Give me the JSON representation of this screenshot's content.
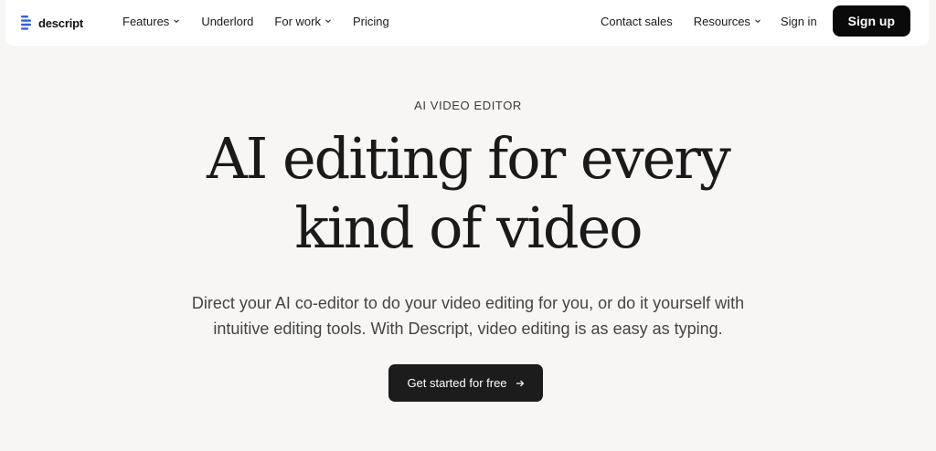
{
  "brand": {
    "name": "descript",
    "accent": "#2f5cff"
  },
  "nav": {
    "links": [
      {
        "label": "Features",
        "has_dropdown": true
      },
      {
        "label": "Underlord",
        "has_dropdown": false
      },
      {
        "label": "For work",
        "has_dropdown": true
      },
      {
        "label": "Pricing",
        "has_dropdown": false
      }
    ],
    "right": {
      "contact_sales": "Contact sales",
      "resources": "Resources",
      "sign_in": "Sign in",
      "sign_up": "Sign up"
    }
  },
  "hero": {
    "eyebrow": "AI VIDEO EDITOR",
    "headline_lines": [
      "AI editing for every",
      "kind of video"
    ],
    "subtitle_lines": [
      "Direct your AI co-editor to do your video editing for you, or do it yourself with",
      "intuitive editing tools. With Descript, video editing is as easy as typing."
    ],
    "cta_label": "Get started for free"
  }
}
